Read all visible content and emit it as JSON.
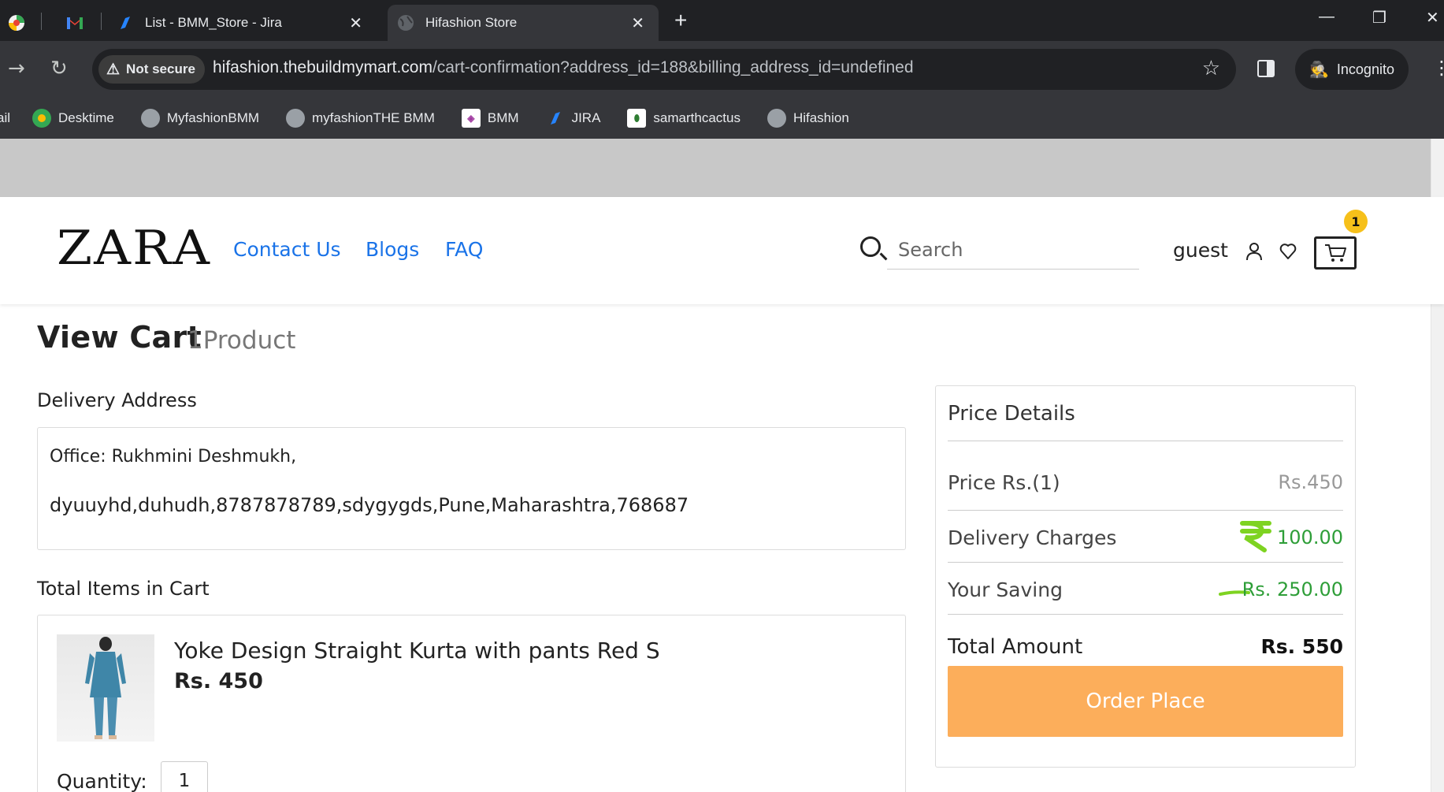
{
  "browser": {
    "tabs": [
      {
        "label": ""
      },
      {
        "label": ""
      },
      {
        "label": "List - BMM_Store - Jira"
      },
      {
        "label": "Hifashion Store"
      }
    ],
    "security_label": "Not secure",
    "url_host": "hifashion.thebuildmymart.com",
    "url_path": "/cart-confirmation?address_id=188&billing_address_id=undefined",
    "incognito_label": "Incognito",
    "bookmarks": [
      {
        "label": "ail"
      },
      {
        "label": "Desktime"
      },
      {
        "label": "MyfashionBMM"
      },
      {
        "label": "myfashionTHE BMM"
      },
      {
        "label": "BMM"
      },
      {
        "label": "JIRA"
      },
      {
        "label": "samarthcactus"
      },
      {
        "label": "Hifashion"
      }
    ]
  },
  "header": {
    "logo": "ZARA",
    "nav": [
      {
        "label": "Contact Us"
      },
      {
        "label": "Blogs"
      },
      {
        "label": "FAQ"
      }
    ],
    "search_placeholder": "Search",
    "user_label": "guest",
    "cart_count": "1",
    "link_color": "#1a73e8"
  },
  "page": {
    "title": "View Cart",
    "product_count": "1Product"
  },
  "delivery": {
    "heading": "Delivery Address",
    "line1": "Office: Rukhmini Deshmukh,",
    "line2": "dyuuyhd,duhudh,8787878789,sdygygds,Pune,Maharashtra,768687"
  },
  "cart": {
    "heading": "Total Items in Cart",
    "items": [
      {
        "name": "Yoke Design Straight Kurta with pants Red S",
        "price": "Rs. 450",
        "quantity_label": "Quantity:",
        "quantity": "1"
      }
    ]
  },
  "price_details": {
    "title": "Price Details",
    "rows": [
      {
        "label": "Price Rs.(1)",
        "value": "Rs.450"
      },
      {
        "label": "Delivery Charges",
        "value": "100.00"
      },
      {
        "label": "Your Saving",
        "value": "Rs. 250.00"
      },
      {
        "label": "Total Amount",
        "value": "Rs. 550"
      }
    ],
    "order_button": "Order Place",
    "colors": {
      "accent": "#fcae5b",
      "green": "#2e9e38",
      "highlight": "#7ed321"
    }
  }
}
